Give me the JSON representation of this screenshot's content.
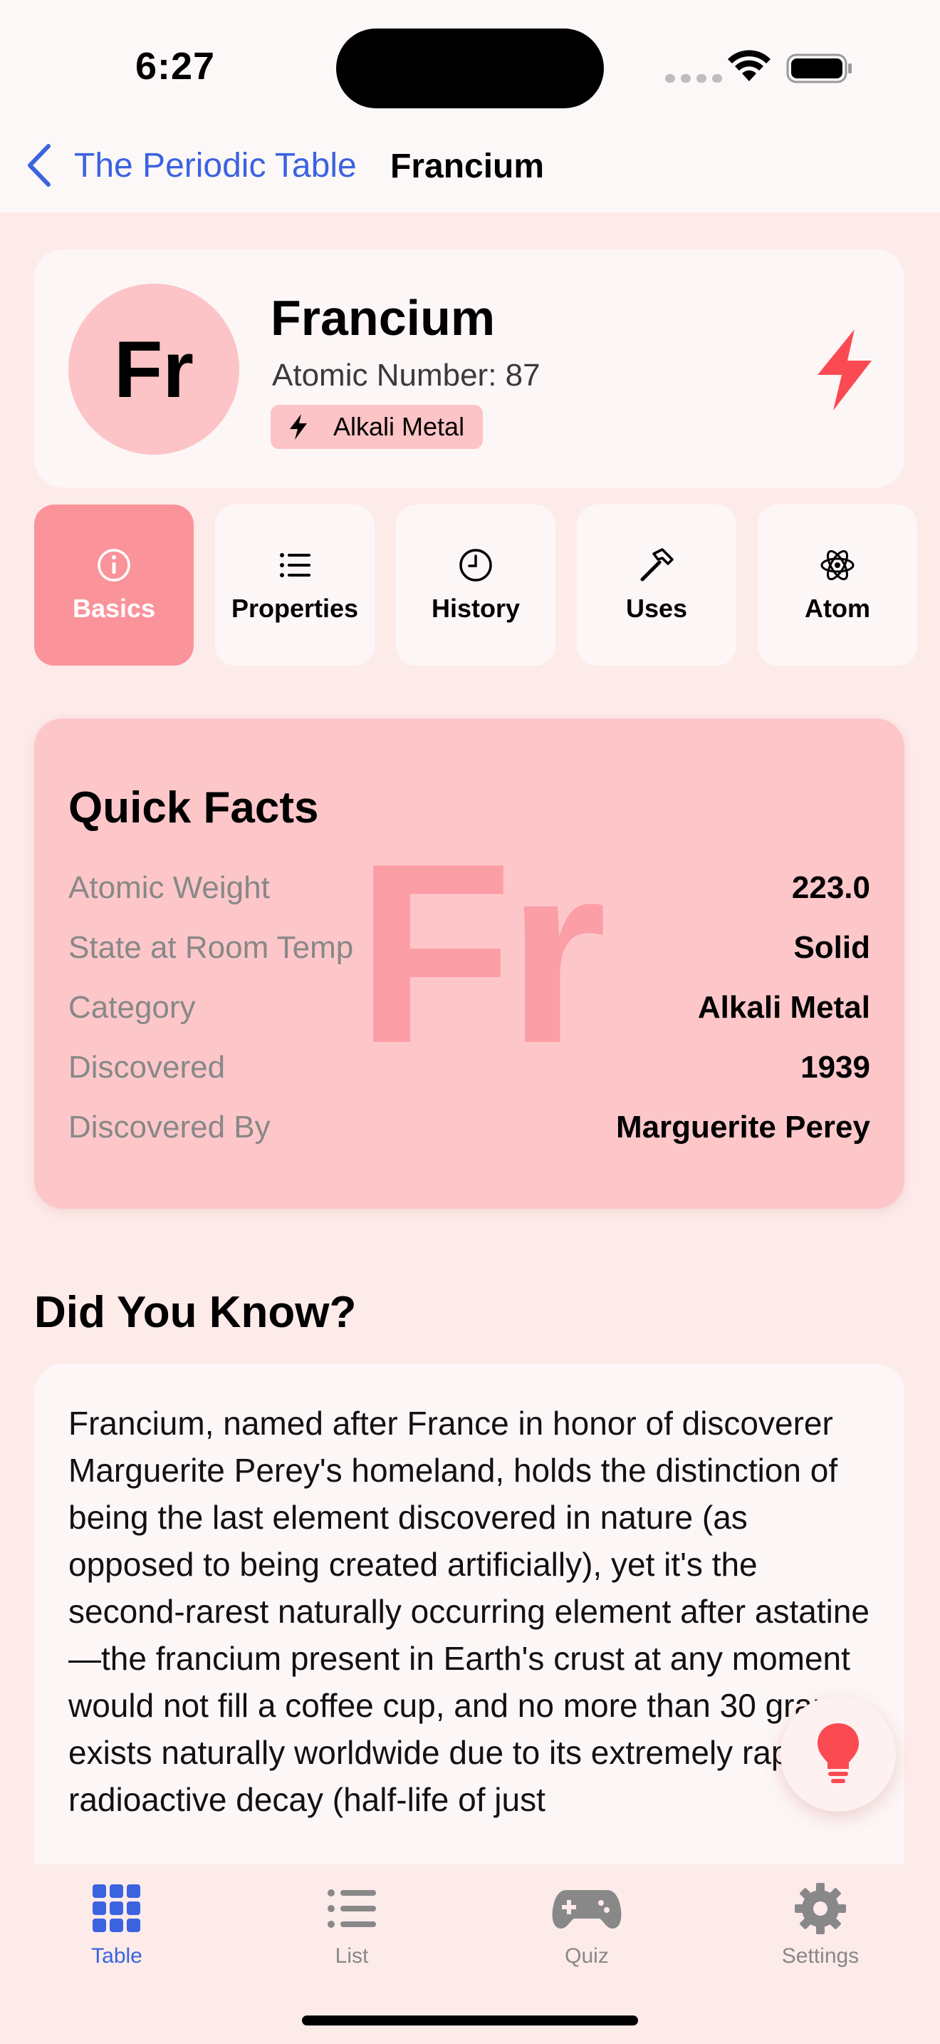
{
  "status_bar": {
    "time": "6:27"
  },
  "nav": {
    "back_label": "The Periodic Table",
    "title": "Francium"
  },
  "element": {
    "symbol": "Fr",
    "name": "Francium",
    "atomic_number_text": "Atomic Number: 87",
    "category_badge": "Alkali Metal",
    "accent_color": "#fb4a52"
  },
  "tabs": [
    {
      "label": "Basics",
      "icon": "info-icon",
      "active": true
    },
    {
      "label": "Properties",
      "icon": "list-icon",
      "active": false
    },
    {
      "label": "History",
      "icon": "clock-icon",
      "active": false
    },
    {
      "label": "Uses",
      "icon": "hammer-icon",
      "active": false
    },
    {
      "label": "Atom",
      "icon": "atom-icon",
      "active": false
    }
  ],
  "quick_facts": {
    "title": "Quick Facts",
    "watermark": "Fr",
    "rows": [
      {
        "label": "Atomic Weight",
        "value": "223.0"
      },
      {
        "label": "State at Room Temp",
        "value": "Solid"
      },
      {
        "label": "Category",
        "value": "Alkali Metal"
      },
      {
        "label": "Discovered",
        "value": "1939"
      },
      {
        "label": "Discovered By",
        "value": "Marguerite Perey"
      }
    ]
  },
  "did_you_know": {
    "title": "Did You Know?",
    "text": "Francium, named after France in honor of discoverer Marguerite Perey's homeland, holds the distinction of being the last element discovered in nature (as opposed to being created artificially), yet it's the second-rarest naturally occurring element after astatine—the francium present in Earth's crust at any moment would not fill a coffee cup, and no more than 30 grams exists naturally worldwide due to its extremely rapid radioactive decay (half-life of just"
  },
  "tab_bar": [
    {
      "label": "Table",
      "icon": "grid-icon",
      "active": true
    },
    {
      "label": "List",
      "icon": "list-icon",
      "active": false
    },
    {
      "label": "Quiz",
      "icon": "gamepad-icon",
      "active": false
    },
    {
      "label": "Settings",
      "icon": "gear-icon",
      "active": false
    }
  ],
  "colors": {
    "accent_blue": "#3b63e0",
    "active_tab": "#fb939a",
    "card_pink": "#fdc7ca",
    "background": "#fdebea"
  }
}
